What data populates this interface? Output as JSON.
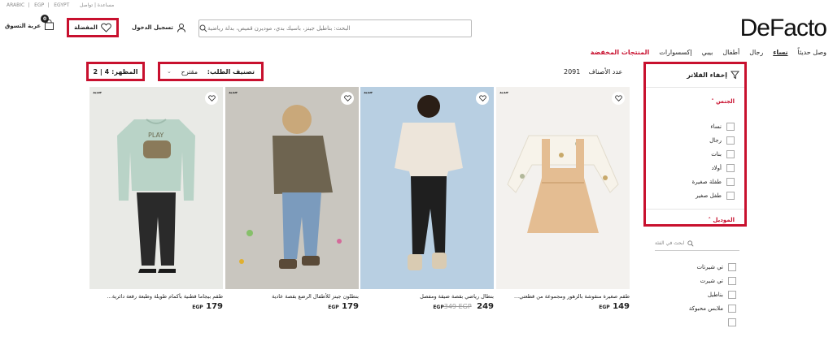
{
  "topbar": {
    "lang": "ARABIC",
    "currency": "EGP",
    "country": "EGYPT",
    "help": "مساعدة | تواصل"
  },
  "header": {
    "logo": "DeFacto",
    "search_placeholder": "البحث: بناطيل جينز، باسيك بدي، موديرن قميص، بدلة رياضية",
    "favorites_label": "المفضلة",
    "login_label": "تسجيل الدخول",
    "cart_label": "عربة التسوق",
    "cart_count": "0"
  },
  "nav": {
    "items": [
      {
        "label": "وصل حديثاً",
        "state": "normal"
      },
      {
        "label": "نساء",
        "state": "active"
      },
      {
        "label": "رجال",
        "state": "normal"
      },
      {
        "label": "أطفال",
        "state": "normal"
      },
      {
        "label": "بيبي",
        "state": "normal"
      },
      {
        "label": "إكسسوارات",
        "state": "normal"
      },
      {
        "label": "المنتجات المخفضة",
        "state": "special"
      }
    ]
  },
  "toolbar": {
    "showing_label": "المظهر:",
    "showing_value": "2 | 4",
    "sort_label": "تصنيف الطلب:",
    "sort_value": "مقترح",
    "product_count": "2091",
    "product_count_label": "عدد الأصناف"
  },
  "filters": {
    "hide_label": "إخفاء الفلاتر",
    "gender_title": "الجنس",
    "gender_options": [
      "نساء",
      "رجال",
      "بنات",
      "أولاد",
      "طفلة صغيرة",
      "طفل صغير"
    ],
    "model_title": "الموديل",
    "category_search_placeholder": "ابحث في الفئة",
    "model_options": [
      "تي شيرتات",
      "تي شيرت",
      "بناطيل",
      "ملابس محبوكة"
    ]
  },
  "products": [
    {
      "tag": "جديد",
      "title": "طقم بيجاما قطنية بأكمام طويلة وطبعة رقعة دائرية...",
      "price": "179",
      "currency": "EGP",
      "old_price": ""
    },
    {
      "tag": "جديد",
      "title": "بنطلون جينز للأطفال الرضع بقصة عادية",
      "price": "179",
      "currency": "EGP",
      "old_price": ""
    },
    {
      "tag": "جديد",
      "title": "بنطال رياضي بقصة ضيقة ومفصل",
      "price": "249",
      "currency": "EGP",
      "old_price": "349 EGP"
    },
    {
      "tag": "جديد",
      "title": "طقم صغيرة منقوشة بالزهور ومجموعة من قطعتي...",
      "price": "149",
      "currency": "EGP",
      "old_price": ""
    }
  ]
}
